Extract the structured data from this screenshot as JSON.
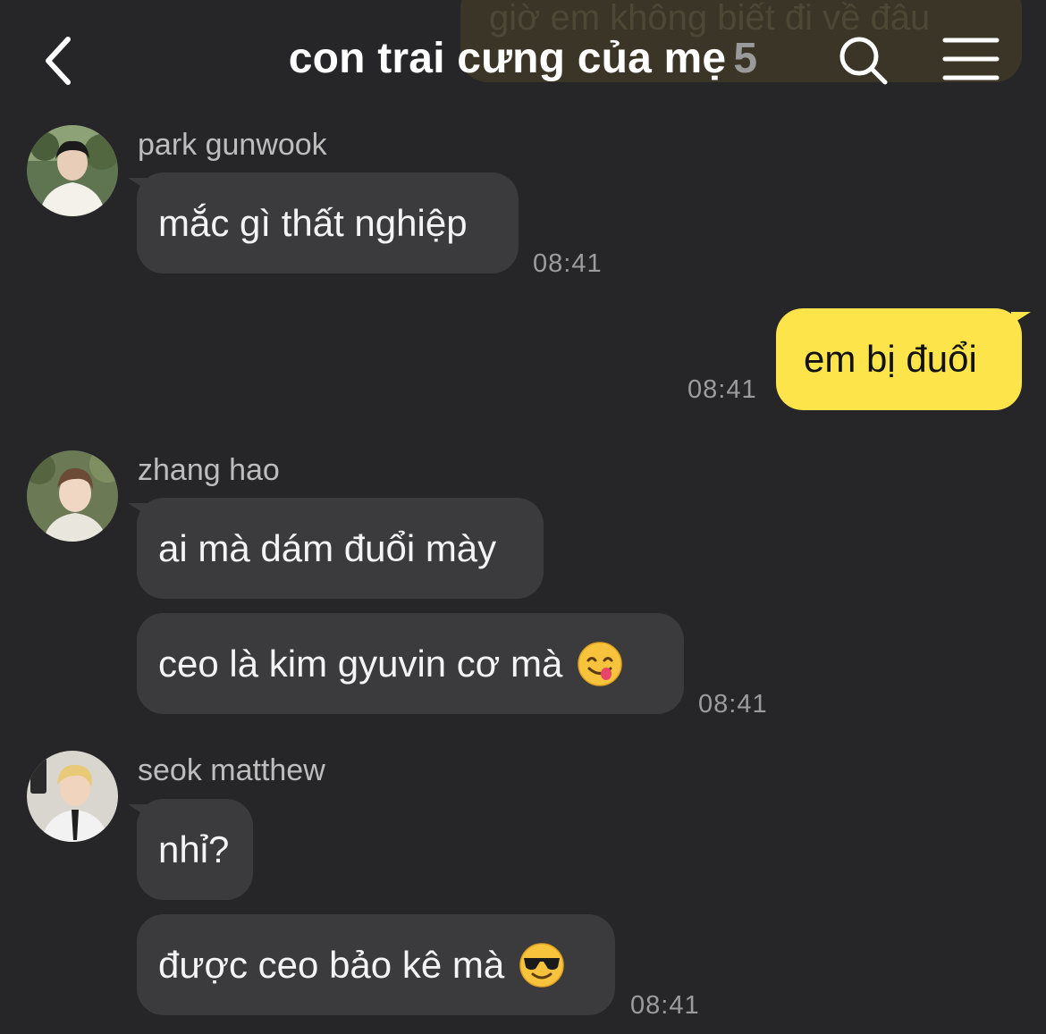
{
  "header": {
    "background_message": "giờ em không biết đi về đâu",
    "title": "con trai cưng của mẹ",
    "member_count": "5",
    "back_icon": "chevron-left-icon",
    "search_icon": "search-icon",
    "menu_icon": "hamburger-menu-icon"
  },
  "colors": {
    "background": "#262628",
    "bubble_other": "#3b3b3e",
    "bubble_mine": "#fde44b"
  },
  "messages": [
    {
      "sender": "park gunwook",
      "bubbles": [
        {
          "text": "mắc gì thất nghiệp",
          "time": "08:41"
        }
      ]
    },
    {
      "sender": "me",
      "bubbles": [
        {
          "text": "em bị đuổi",
          "time": "08:41"
        }
      ]
    },
    {
      "sender": "zhang hao",
      "bubbles": [
        {
          "text": "ai mà dám đuổi mày"
        },
        {
          "text": "ceo là kim gyuvin cơ mà",
          "emoji": "yum-face-emoji",
          "time": "08:41"
        }
      ]
    },
    {
      "sender": "seok matthew",
      "bubbles": [
        {
          "text": "nhỉ?"
        },
        {
          "text": "được ceo bảo kê mà",
          "emoji": "sunglasses-face-emoji",
          "time": "08:41"
        }
      ]
    }
  ]
}
